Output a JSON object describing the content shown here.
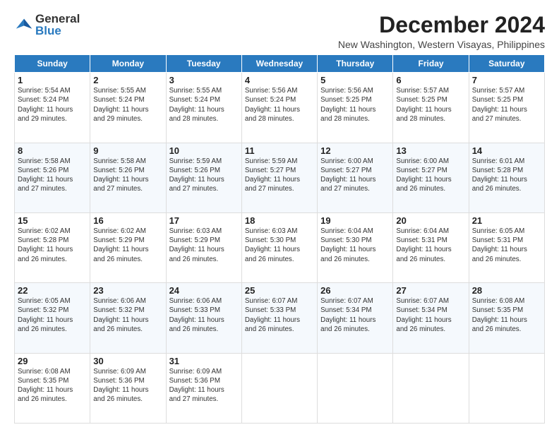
{
  "header": {
    "logo_general": "General",
    "logo_blue": "Blue",
    "main_title": "December 2024",
    "subtitle": "New Washington, Western Visayas, Philippines"
  },
  "weekdays": [
    "Sunday",
    "Monday",
    "Tuesday",
    "Wednesday",
    "Thursday",
    "Friday",
    "Saturday"
  ],
  "weeks": [
    [
      {
        "day": "1",
        "info": "Sunrise: 5:54 AM\nSunset: 5:24 PM\nDaylight: 11 hours\nand 29 minutes."
      },
      {
        "day": "2",
        "info": "Sunrise: 5:55 AM\nSunset: 5:24 PM\nDaylight: 11 hours\nand 29 minutes."
      },
      {
        "day": "3",
        "info": "Sunrise: 5:55 AM\nSunset: 5:24 PM\nDaylight: 11 hours\nand 28 minutes."
      },
      {
        "day": "4",
        "info": "Sunrise: 5:56 AM\nSunset: 5:24 PM\nDaylight: 11 hours\nand 28 minutes."
      },
      {
        "day": "5",
        "info": "Sunrise: 5:56 AM\nSunset: 5:25 PM\nDaylight: 11 hours\nand 28 minutes."
      },
      {
        "day": "6",
        "info": "Sunrise: 5:57 AM\nSunset: 5:25 PM\nDaylight: 11 hours\nand 28 minutes."
      },
      {
        "day": "7",
        "info": "Sunrise: 5:57 AM\nSunset: 5:25 PM\nDaylight: 11 hours\nand 27 minutes."
      }
    ],
    [
      {
        "day": "8",
        "info": "Sunrise: 5:58 AM\nSunset: 5:26 PM\nDaylight: 11 hours\nand 27 minutes."
      },
      {
        "day": "9",
        "info": "Sunrise: 5:58 AM\nSunset: 5:26 PM\nDaylight: 11 hours\nand 27 minutes."
      },
      {
        "day": "10",
        "info": "Sunrise: 5:59 AM\nSunset: 5:26 PM\nDaylight: 11 hours\nand 27 minutes."
      },
      {
        "day": "11",
        "info": "Sunrise: 5:59 AM\nSunset: 5:27 PM\nDaylight: 11 hours\nand 27 minutes."
      },
      {
        "day": "12",
        "info": "Sunrise: 6:00 AM\nSunset: 5:27 PM\nDaylight: 11 hours\nand 27 minutes."
      },
      {
        "day": "13",
        "info": "Sunrise: 6:00 AM\nSunset: 5:27 PM\nDaylight: 11 hours\nand 26 minutes."
      },
      {
        "day": "14",
        "info": "Sunrise: 6:01 AM\nSunset: 5:28 PM\nDaylight: 11 hours\nand 26 minutes."
      }
    ],
    [
      {
        "day": "15",
        "info": "Sunrise: 6:02 AM\nSunset: 5:28 PM\nDaylight: 11 hours\nand 26 minutes."
      },
      {
        "day": "16",
        "info": "Sunrise: 6:02 AM\nSunset: 5:29 PM\nDaylight: 11 hours\nand 26 minutes."
      },
      {
        "day": "17",
        "info": "Sunrise: 6:03 AM\nSunset: 5:29 PM\nDaylight: 11 hours\nand 26 minutes."
      },
      {
        "day": "18",
        "info": "Sunrise: 6:03 AM\nSunset: 5:30 PM\nDaylight: 11 hours\nand 26 minutes."
      },
      {
        "day": "19",
        "info": "Sunrise: 6:04 AM\nSunset: 5:30 PM\nDaylight: 11 hours\nand 26 minutes."
      },
      {
        "day": "20",
        "info": "Sunrise: 6:04 AM\nSunset: 5:31 PM\nDaylight: 11 hours\nand 26 minutes."
      },
      {
        "day": "21",
        "info": "Sunrise: 6:05 AM\nSunset: 5:31 PM\nDaylight: 11 hours\nand 26 minutes."
      }
    ],
    [
      {
        "day": "22",
        "info": "Sunrise: 6:05 AM\nSunset: 5:32 PM\nDaylight: 11 hours\nand 26 minutes."
      },
      {
        "day": "23",
        "info": "Sunrise: 6:06 AM\nSunset: 5:32 PM\nDaylight: 11 hours\nand 26 minutes."
      },
      {
        "day": "24",
        "info": "Sunrise: 6:06 AM\nSunset: 5:33 PM\nDaylight: 11 hours\nand 26 minutes."
      },
      {
        "day": "25",
        "info": "Sunrise: 6:07 AM\nSunset: 5:33 PM\nDaylight: 11 hours\nand 26 minutes."
      },
      {
        "day": "26",
        "info": "Sunrise: 6:07 AM\nSunset: 5:34 PM\nDaylight: 11 hours\nand 26 minutes."
      },
      {
        "day": "27",
        "info": "Sunrise: 6:07 AM\nSunset: 5:34 PM\nDaylight: 11 hours\nand 26 minutes."
      },
      {
        "day": "28",
        "info": "Sunrise: 6:08 AM\nSunset: 5:35 PM\nDaylight: 11 hours\nand 26 minutes."
      }
    ],
    [
      {
        "day": "29",
        "info": "Sunrise: 6:08 AM\nSunset: 5:35 PM\nDaylight: 11 hours\nand 26 minutes."
      },
      {
        "day": "30",
        "info": "Sunrise: 6:09 AM\nSunset: 5:36 PM\nDaylight: 11 hours\nand 26 minutes."
      },
      {
        "day": "31",
        "info": "Sunrise: 6:09 AM\nSunset: 5:36 PM\nDaylight: 11 hours\nand 27 minutes."
      },
      {
        "day": "",
        "info": ""
      },
      {
        "day": "",
        "info": ""
      },
      {
        "day": "",
        "info": ""
      },
      {
        "day": "",
        "info": ""
      }
    ]
  ]
}
